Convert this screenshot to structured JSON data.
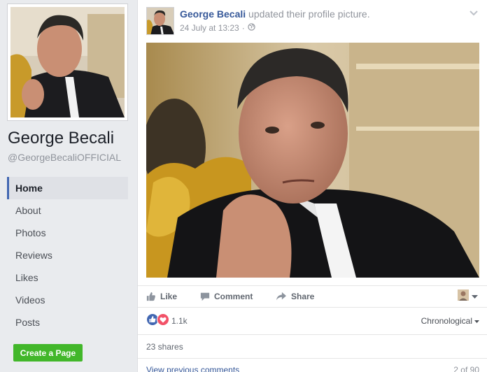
{
  "page": {
    "name": "George Becali",
    "handle": "@GeorgeBecaliOFFICIAL"
  },
  "nav": [
    {
      "label": "Home",
      "active": true
    },
    {
      "label": "About"
    },
    {
      "label": "Photos"
    },
    {
      "label": "Reviews"
    },
    {
      "label": "Likes"
    },
    {
      "label": "Videos"
    },
    {
      "label": "Posts"
    }
  ],
  "create_page_label": "Create a Page",
  "post": {
    "author": "George Becali",
    "action": "updated their profile picture.",
    "timestamp": "24 July at 13:23",
    "separator": "·",
    "audience_icon": "globe-icon"
  },
  "actions": {
    "like": "Like",
    "comment": "Comment",
    "share": "Share"
  },
  "reactions": {
    "count": "1.1k",
    "types": [
      "like",
      "love"
    ]
  },
  "order": "Chronological",
  "shares": "23 shares",
  "comments": {
    "view_previous": "View previous comments",
    "pager": "2 of 90"
  },
  "colors": {
    "link": "#365899",
    "like_blue": "#4267b2",
    "love_red": "#f25268",
    "create_green": "#42b72a"
  }
}
